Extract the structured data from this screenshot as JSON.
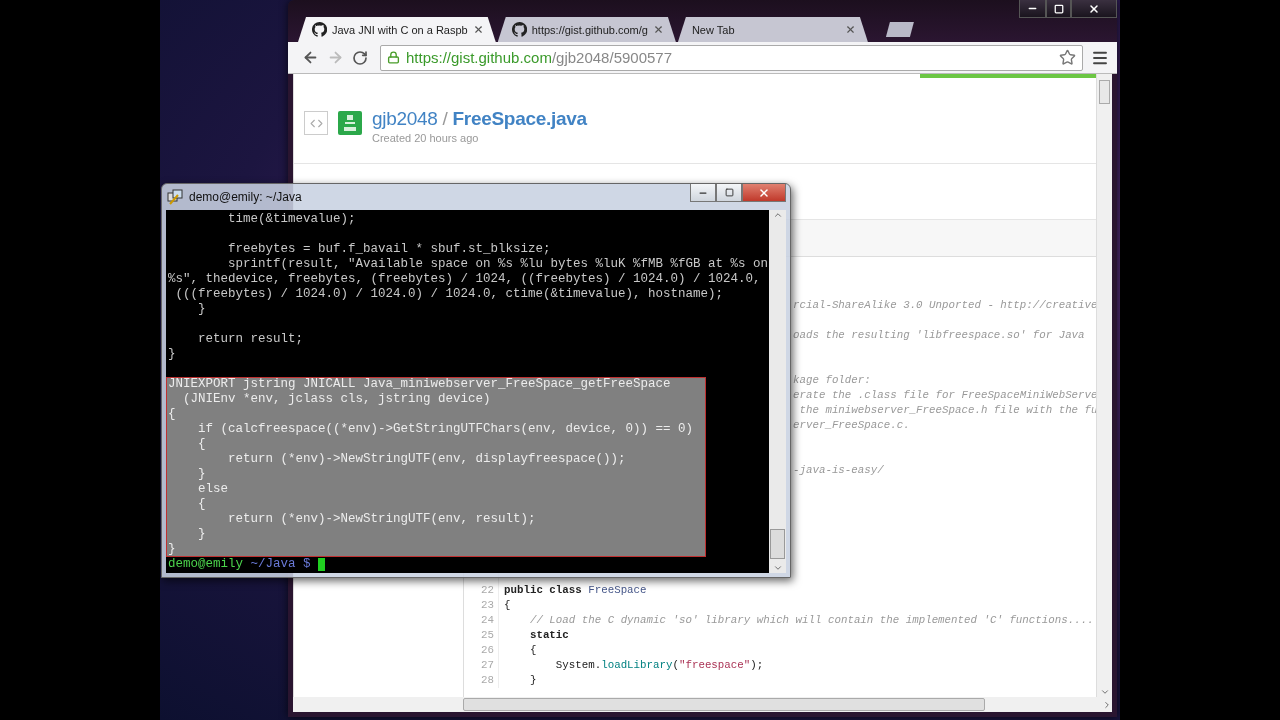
{
  "browser": {
    "tabs": [
      {
        "title": "Java JNI with C on a Raspb",
        "selected": true
      },
      {
        "title": "https://gist.github.com/g",
        "selected": false
      },
      {
        "title": "New Tab",
        "selected": false
      }
    ],
    "address": {
      "origin": "https://gist.github.com",
      "path": "/gjb2048/5900577"
    },
    "gist": {
      "owner": "gjb2048",
      "separator": "/",
      "file": "FreeSpace.java",
      "created": "Created 20 hours ago"
    },
    "code_lines": [
      {
        "kind": "blank"
      },
      {
        "kind": "blank"
      },
      {
        "kind": "fragment",
        "text": "rcial-ShareAlike 3.0 Unported - http://creative"
      },
      {
        "kind": "blank"
      },
      {
        "kind": "fragment",
        "text": "oads the resulting 'libfreespace.so' for Java"
      },
      {
        "kind": "blank"
      },
      {
        "kind": "blank"
      },
      {
        "kind": "fragment",
        "text": "kage folder:"
      },
      {
        "kind": "fragment",
        "text": "erate the .class file for FreeSpaceMiniWebServe"
      },
      {
        "kind": "fragment",
        "text": " the miniwebserver_FreeSpace.h file with the fu"
      },
      {
        "kind": "fragment",
        "text": "erver_FreeSpace.c."
      },
      {
        "kind": "blank"
      },
      {
        "kind": "blank"
      },
      {
        "kind": "fragment",
        "text": "-java-is-easy/"
      },
      {
        "kind": "blank"
      },
      {
        "kind": "blank"
      },
      {
        "kind": "blank"
      },
      {
        "kind": "blank"
      },
      {
        "kind": "blank"
      },
      {
        "kind": "blank"
      },
      {
        "kind": "blank"
      },
      {
        "kind": "numbered",
        "number": "22",
        "tokens": [
          {
            "kind": "keyword",
            "text": "public class "
          },
          {
            "kind": "classname",
            "text": "FreeSpace"
          }
        ]
      },
      {
        "kind": "numbered",
        "number": "23",
        "tokens": [
          {
            "kind": "plain",
            "text": "{"
          }
        ]
      },
      {
        "kind": "numbered",
        "number": "24",
        "tokens": [
          {
            "kind": "comment",
            "text": "    // Load the C dynamic 'so' library which will contain the implemented 'C' functions...."
          }
        ]
      },
      {
        "kind": "numbered",
        "number": "25",
        "tokens": [
          {
            "kind": "keyword",
            "text": "    static"
          }
        ]
      },
      {
        "kind": "numbered",
        "number": "26",
        "tokens": [
          {
            "kind": "plain",
            "text": "    {"
          }
        ]
      },
      {
        "kind": "numbered",
        "number": "27",
        "tokens": [
          {
            "kind": "plain",
            "text": "        System."
          },
          {
            "kind": "method",
            "text": "loadLibrary"
          },
          {
            "kind": "plain",
            "text": "("
          },
          {
            "kind": "string",
            "text": "\"freespace\""
          },
          {
            "kind": "plain",
            "text": ");"
          }
        ]
      },
      {
        "kind": "numbered",
        "number": "28",
        "tokens": [
          {
            "kind": "plain",
            "text": "    }"
          }
        ]
      }
    ]
  },
  "terminal": {
    "title": "demo@emily: ~/Java",
    "lines": [
      {
        "kind": "text",
        "text": "        time(&timevalue);",
        "selected": false
      },
      {
        "kind": "blank"
      },
      {
        "kind": "text",
        "text": "        freebytes = buf.f_bavail * sbuf.st_blksize;",
        "selected": false
      },
      {
        "kind": "text",
        "text": "        sprintf(result, \"Available space on %s %lu bytes %luK %fMB %fGB at %s on",
        "selected": false
      },
      {
        "kind": "text",
        "text": "%s\", thedevice, freebytes, (freebytes) / 1024, ((freebytes) / 1024.0) / 1024.0,",
        "selected": false
      },
      {
        "kind": "text",
        "text": " (((freebytes) / 1024.0) / 1024.0) / 1024.0, ctime(&timevalue), hostname);",
        "selected": false
      },
      {
        "kind": "text",
        "text": "    }",
        "selected": false
      },
      {
        "kind": "blank"
      },
      {
        "kind": "text",
        "text": "    return result;",
        "selected": false
      },
      {
        "kind": "text",
        "text": "}",
        "selected": false
      },
      {
        "kind": "blank"
      },
      {
        "kind": "text",
        "text": "JNIEXPORT jstring JNICALL Java_miniwebserver_FreeSpace_getFreeSpace",
        "selected": true
      },
      {
        "kind": "text",
        "text": "  (JNIEnv *env, jclass cls, jstring device)",
        "selected": true
      },
      {
        "kind": "text",
        "text": "{",
        "selected": true
      },
      {
        "kind": "text",
        "text": "    if (calcfreespace((*env)->GetStringUTFChars(env, device, 0)) == 0)",
        "selected": true
      },
      {
        "kind": "text",
        "text": "    {",
        "selected": true
      },
      {
        "kind": "text",
        "text": "        return (*env)->NewStringUTF(env, displayfreespace());",
        "selected": true
      },
      {
        "kind": "text",
        "text": "    }",
        "selected": true
      },
      {
        "kind": "text",
        "text": "    else",
        "selected": true
      },
      {
        "kind": "text",
        "text": "    {",
        "selected": true
      },
      {
        "kind": "text",
        "text": "        return (*env)->NewStringUTF(env, result);",
        "selected": true
      },
      {
        "kind": "text",
        "text": "    }",
        "selected": true
      },
      {
        "kind": "text",
        "text": "}",
        "selected": true
      }
    ],
    "prompt": {
      "user_host": "demo@emily",
      "path": "~/Java $"
    }
  }
}
